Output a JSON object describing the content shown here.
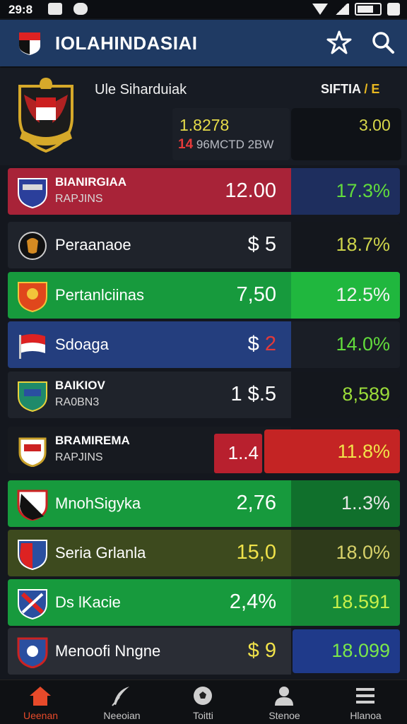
{
  "status_bar": {
    "time": "29:8"
  },
  "app_bar": {
    "title": "IOLAHINDASIAI"
  },
  "club": {
    "name": "Ule Siharduiak",
    "setting_label": "SIFTIA",
    "setting_extra": "/ E",
    "odds": "1.8278",
    "sub_code": "14",
    "sub_text": "96MCTD 2BW",
    "right_value": "3.00"
  },
  "rows": [
    {
      "team_line1": "BIANIRGIAA",
      "team_line2": "RAPJINS",
      "price": "12.00",
      "pct": "17.3%"
    },
    {
      "team_line1": "Peraanaoe",
      "price": "$ 5",
      "pct": "18.7%"
    },
    {
      "team_line1": "Pertanlciinas",
      "price": "7,50",
      "pct": "12.5%"
    },
    {
      "team_line1": "Sdoaga",
      "price": "$",
      "price_accent": "2",
      "pct": "14.0%"
    },
    {
      "team_line1": "BAIKIOV",
      "team_line2": "RA0BN3",
      "price": "1 $.5",
      "pct": "8,589"
    },
    {
      "team_line1": "BRAMIREMA",
      "team_line2": "RAPJINS",
      "price": "1..4",
      "pct": "11.8%"
    },
    {
      "team_line1": "MnohSigyka",
      "price": "2,76",
      "pct": "1..3%"
    },
    {
      "team_line1": "Seria Grlanla",
      "price": "15,0",
      "pct": "18.0%"
    },
    {
      "team_line1": "Ds lKacie",
      "price": "2,4%",
      "pct": "18.591"
    },
    {
      "team_line1": "Menoofi Nngne",
      "price": "$ 9",
      "pct": "18.099"
    }
  ],
  "bottom_nav": [
    {
      "label": "Ueenan",
      "icon": "home-icon"
    },
    {
      "label": "Neeoian",
      "icon": "feather-icon"
    },
    {
      "label": "Toitti",
      "icon": "ball-icon"
    },
    {
      "label": "Stenoe",
      "icon": "person-icon"
    },
    {
      "label": "Hlanoa",
      "icon": "menu-icon"
    }
  ],
  "colors": {
    "app_bar": "#1f3a63",
    "red_row": "#a82338",
    "green_row": "#169b3c",
    "blue_row": "#243e7e",
    "olive_row": "#3d4a1e",
    "pct_green": "#62dc3c",
    "nav_active": "#e84a2a"
  }
}
